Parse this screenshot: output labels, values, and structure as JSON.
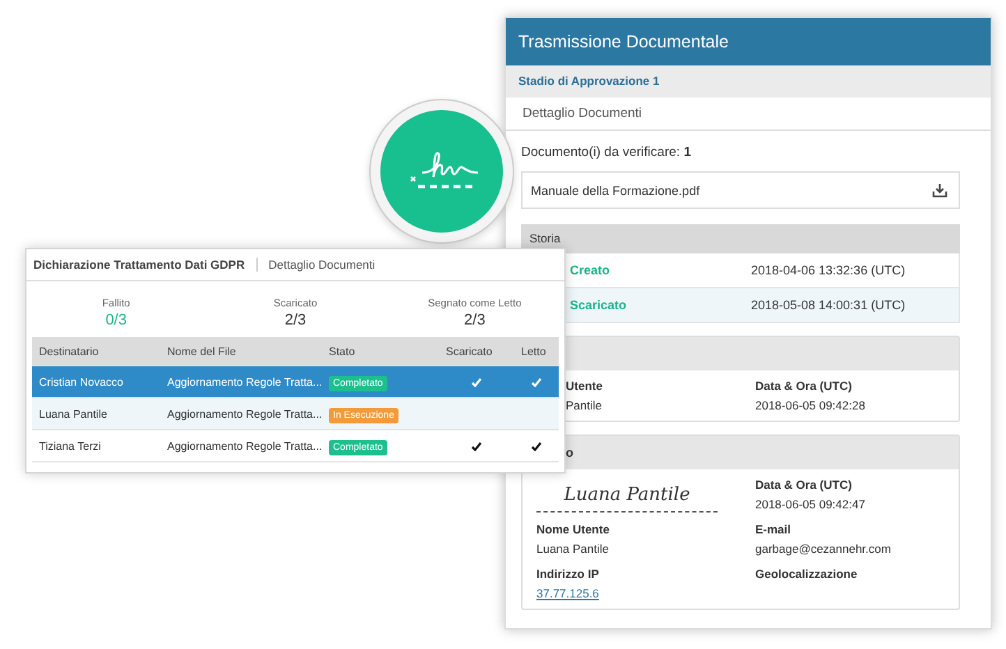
{
  "document_panel": {
    "title": "Trasmissione Documentale",
    "stage": "Stadio di Approvazione 1",
    "tab": "Dettaglio Documenti",
    "documents_label": "Documento(i) da verificare: **1**",
    "file": {
      "name": "Manuale della Formazione.pdf"
    },
    "history": {
      "title": "Storia",
      "rows": [
        {
          "event": "Creato",
          "time": "2018-04-06 13:32:36 (UTC)",
          "hovered": false
        },
        {
          "event": "Scaricato",
          "time": "2018-05-08 14:00:31 (UTC)",
          "hovered": true
        }
      ]
    },
    "cards": [
      {
        "fields": [
          {
            "label": "Utente",
            "value": "Pantile"
          },
          {
            "label": "Data & Ora (UTC)",
            "value": "2018-06-05 09:42:28"
          }
        ]
      },
      {
        "title": "o",
        "signature": "Luana Pantile",
        "fields": [
          {
            "label": "Data & Ora (UTC)",
            "value": "2018-06-05 09:42:47"
          },
          {
            "label": "Nome Utente",
            "value": "Luana Pantile"
          },
          {
            "label": "E-mail",
            "value": "garbage@cezannehr.com"
          },
          {
            "label": "Indirizzo IP",
            "value": "37.77.125.6",
            "kind": "link"
          },
          {
            "label": "Geolocalizzazione"
          }
        ]
      }
    ]
  },
  "gdpr_panel": {
    "title": "Dichiarazione Trattamento Dati GDPR",
    "tab": "Dettaglio Documenti",
    "stats": [
      {
        "label": "Fallito",
        "value": "0/3",
        "color": "#1cb48c"
      },
      {
        "label": "Scaricato",
        "value": "2/3",
        "color": "#333333"
      },
      {
        "label": "Segnato come Letto",
        "value": "2/3",
        "color": "#333333"
      }
    ],
    "table": {
      "columns": [
        "Destinatario",
        "Nome del File",
        "Stato",
        "Scaricato",
        "Letto"
      ],
      "rows": [
        {
          "recipient": "Cristian Novacco",
          "file": "Aggiornamento Regole Tratta...",
          "status": {
            "label": "Completato",
            "color": "#1dbf8e"
          },
          "downloaded": true,
          "read": true,
          "selected": true,
          "hovered": false
        },
        {
          "recipient": "Luana Pantile",
          "file": "Aggiornamento Regole Tratta...",
          "status": {
            "label": "In Esecuzione",
            "color": "#f39a3a"
          },
          "downloaded": false,
          "read": false,
          "selected": false,
          "hovered": true
        },
        {
          "recipient": "Tiziana Terzi",
          "file": "Aggiornamento Regole Tratta...",
          "status": {
            "label": "Completato",
            "color": "#1dbf8e"
          },
          "downloaded": true,
          "read": true,
          "selected": false,
          "hovered": false
        }
      ]
    }
  }
}
